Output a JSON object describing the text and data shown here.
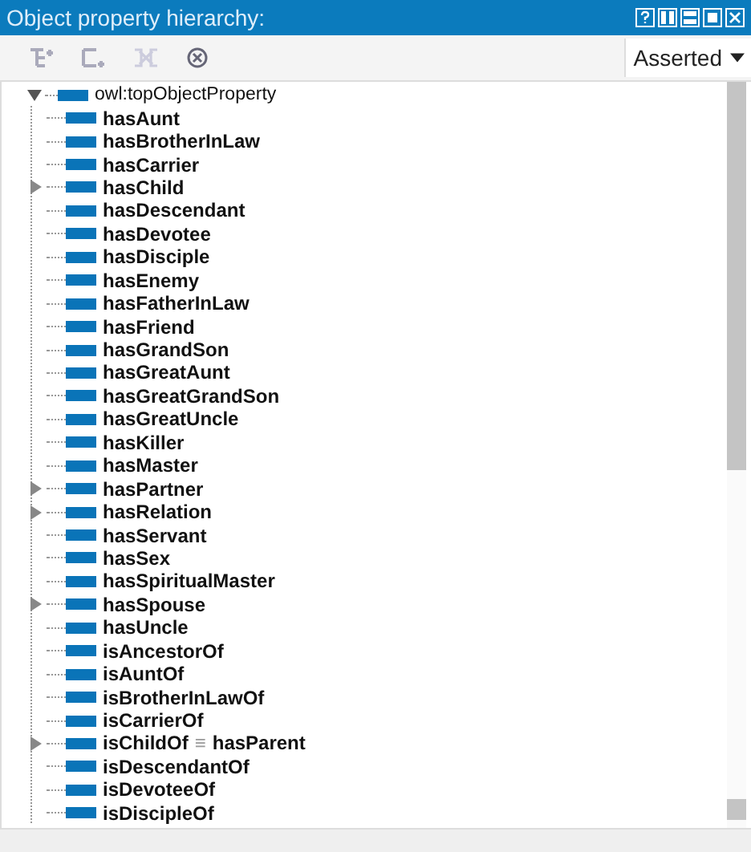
{
  "window": {
    "title": "Object property hierarchy:"
  },
  "toolbar": {
    "view_mode": "Asserted"
  },
  "tree": {
    "label": "owl:topObjectProperty",
    "expanded": true,
    "children": [
      {
        "label": "hasAunt",
        "kind": "leaf"
      },
      {
        "label": "hasBrotherInLaw",
        "kind": "leaf"
      },
      {
        "label": "hasCarrier",
        "kind": "leaf"
      },
      {
        "label": "hasChild",
        "kind": "branch"
      },
      {
        "label": "hasDescendant",
        "kind": "leaf"
      },
      {
        "label": "hasDevotee",
        "kind": "leaf"
      },
      {
        "label": "hasDisciple",
        "kind": "leaf"
      },
      {
        "label": "hasEnemy",
        "kind": "leaf"
      },
      {
        "label": "hasFatherInLaw",
        "kind": "leaf"
      },
      {
        "label": "hasFriend",
        "kind": "leaf"
      },
      {
        "label": "hasGrandSon",
        "kind": "leaf"
      },
      {
        "label": "hasGreatAunt",
        "kind": "leaf"
      },
      {
        "label": "hasGreatGrandSon",
        "kind": "leaf"
      },
      {
        "label": "hasGreatUncle",
        "kind": "leaf"
      },
      {
        "label": "hasKiller",
        "kind": "leaf"
      },
      {
        "label": "hasMaster",
        "kind": "leaf"
      },
      {
        "label": "hasPartner",
        "kind": "branch"
      },
      {
        "label": "hasRelation",
        "kind": "branch"
      },
      {
        "label": "hasServant",
        "kind": "leaf"
      },
      {
        "label": "hasSex",
        "kind": "leaf"
      },
      {
        "label": "hasSpiritualMaster",
        "kind": "leaf"
      },
      {
        "label": "hasSpouse",
        "kind": "branch"
      },
      {
        "label": "hasUncle",
        "kind": "leaf"
      },
      {
        "label": "isAncestorOf",
        "kind": "leaf"
      },
      {
        "label": "isAuntOf",
        "kind": "leaf"
      },
      {
        "label": "isBrotherInLawOf",
        "kind": "leaf"
      },
      {
        "label": "isCarrierOf",
        "kind": "leaf"
      },
      {
        "label": "isChildOf",
        "kind": "branch",
        "equivalent_sign": "≡",
        "equivalent": "hasParent"
      },
      {
        "label": "isDescendantOf",
        "kind": "leaf"
      },
      {
        "label": "isDevoteeOf",
        "kind": "leaf"
      },
      {
        "label": "isDiscipleOf",
        "kind": "leaf"
      }
    ]
  }
}
